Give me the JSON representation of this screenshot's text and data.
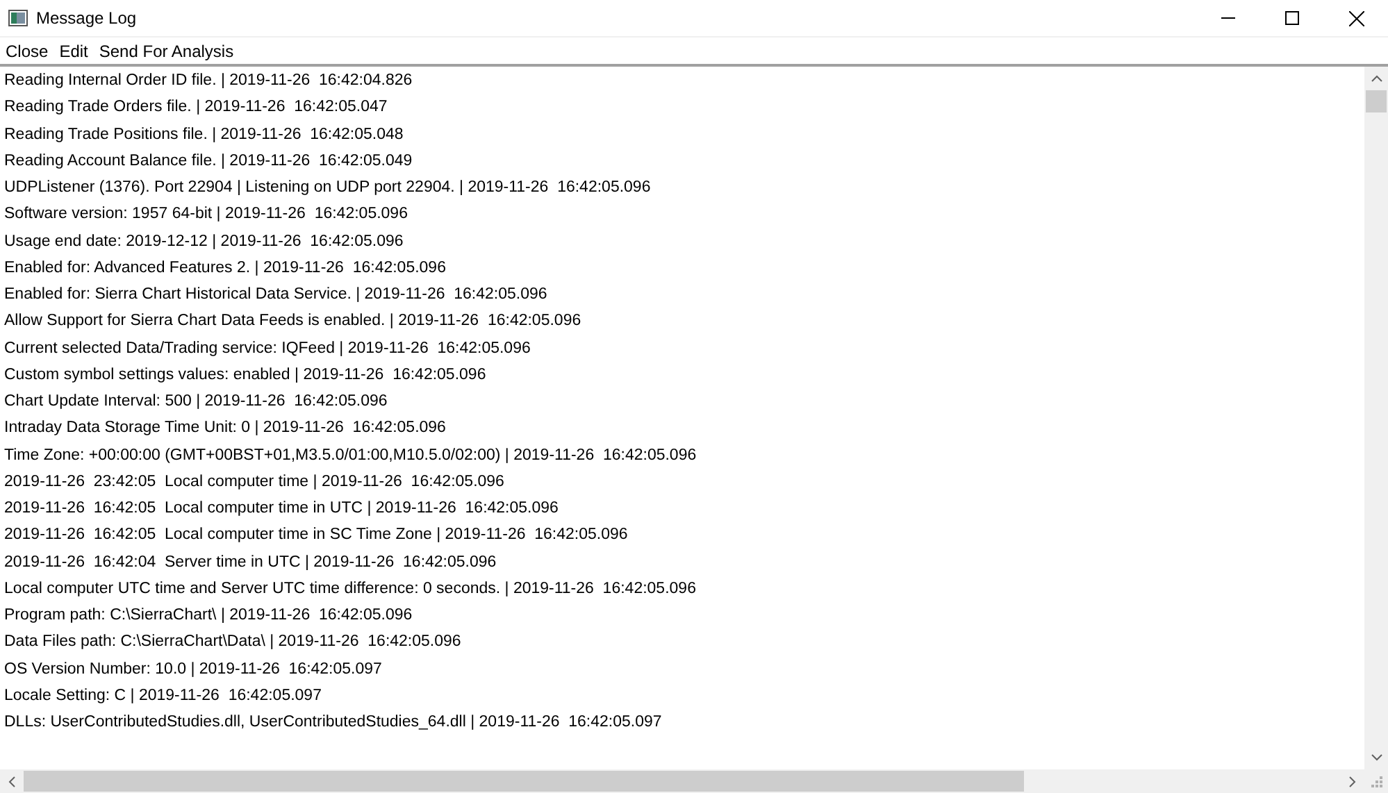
{
  "window": {
    "title": "Message Log"
  },
  "menu": [
    "Close",
    "Edit",
    "Send For Analysis"
  ],
  "log": [
    "Reading Internal Order ID file. | 2019-11-26  16:42:04.826",
    "Reading Trade Orders file. | 2019-11-26  16:42:05.047",
    "Reading Trade Positions file. | 2019-11-26  16:42:05.048",
    "Reading Account Balance file. | 2019-11-26  16:42:05.049",
    "UDPListener (1376). Port 22904 | Listening on UDP port 22904. | 2019-11-26  16:42:05.096",
    "Software version: 1957 64-bit | 2019-11-26  16:42:05.096",
    "Usage end date: 2019-12-12 | 2019-11-26  16:42:05.096",
    "Enabled for: Advanced Features 2. | 2019-11-26  16:42:05.096",
    "Enabled for: Sierra Chart Historical Data Service. | 2019-11-26  16:42:05.096",
    "Allow Support for Sierra Chart Data Feeds is enabled. | 2019-11-26  16:42:05.096",
    "Current selected Data/Trading service: IQFeed | 2019-11-26  16:42:05.096",
    "Custom symbol settings values: enabled | 2019-11-26  16:42:05.096",
    "Chart Update Interval: 500 | 2019-11-26  16:42:05.096",
    "Intraday Data Storage Time Unit: 0 | 2019-11-26  16:42:05.096",
    "Time Zone: +00:00:00 (GMT+00BST+01,M3.5.0/01:00,M10.5.0/02:00) | 2019-11-26  16:42:05.096",
    "2019-11-26  23:42:05  Local computer time | 2019-11-26  16:42:05.096",
    "2019-11-26  16:42:05  Local computer time in UTC | 2019-11-26  16:42:05.096",
    "2019-11-26  16:42:05  Local computer time in SC Time Zone | 2019-11-26  16:42:05.096",
    "2019-11-26  16:42:04  Server time in UTC | 2019-11-26  16:42:05.096",
    "Local computer UTC time and Server UTC time difference: 0 seconds. | 2019-11-26  16:42:05.096",
    "Program path: C:\\SierraChart\\ | 2019-11-26  16:42:05.096",
    "Data Files path: C:\\SierraChart\\Data\\ | 2019-11-26  16:42:05.096",
    "OS Version Number: 10.0 | 2019-11-26  16:42:05.097",
    "Locale Setting: C | 2019-11-26  16:42:05.097",
    "DLLs: UserContributedStudies.dll, UserContributedStudies_64.dll | 2019-11-26  16:42:05.097"
  ]
}
